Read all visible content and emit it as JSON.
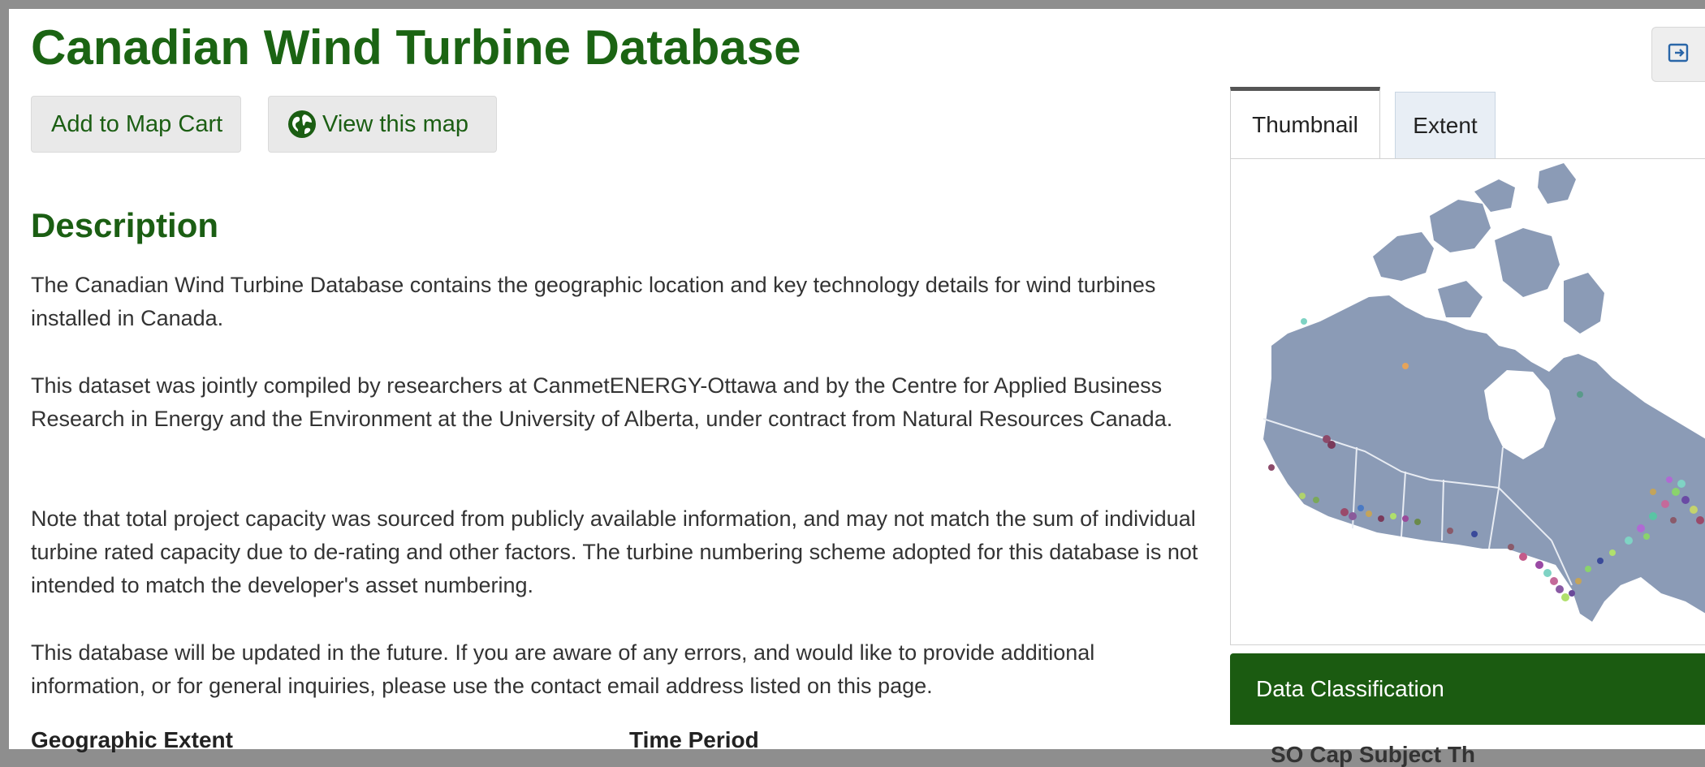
{
  "page": {
    "title": "Canadian Wind Turbine Database"
  },
  "actions": {
    "add_to_cart": "Add to Map Cart",
    "view_map": "View this map"
  },
  "description": {
    "heading": "Description",
    "paragraphs": [
      "The Canadian Wind Turbine Database contains the geographic location and key technology details for wind turbines installed in Canada.",
      "This dataset was jointly compiled by researchers at CanmetENERGY-Ottawa and by the Centre for Applied Business Research in Energy and the Environment at the University of Alberta, under contract from Natural Resources Canada.",
      "Note that total project capacity was sourced from publicly available information, and may not match the sum of individual turbine rated capacity due to de-rating and other factors. The turbine numbering scheme adopted for this database is not intended to match the developer's asset numbering.",
      "This database will be updated in the future. If you are aware of any errors, and would like to provide additional information, or for general inquiries, please use the contact email address listed on this page."
    ]
  },
  "details": {
    "geographic_extent_label": "Geographic Extent",
    "time_period_label": "Time Period"
  },
  "side_panel": {
    "tabs": [
      "Thumbnail",
      "Extent"
    ],
    "active_tab": "Thumbnail",
    "data_classification_label": "Data Classification",
    "partial_subheading": "SO Cap Subject Th"
  },
  "icons": {
    "globe": "globe-icon",
    "share": "external-share-icon"
  },
  "colors": {
    "title_green": "#1b6413",
    "header_bar_green": "#1b5b11",
    "map_land": "#8b9bb6",
    "map_water": "#ffffff"
  }
}
